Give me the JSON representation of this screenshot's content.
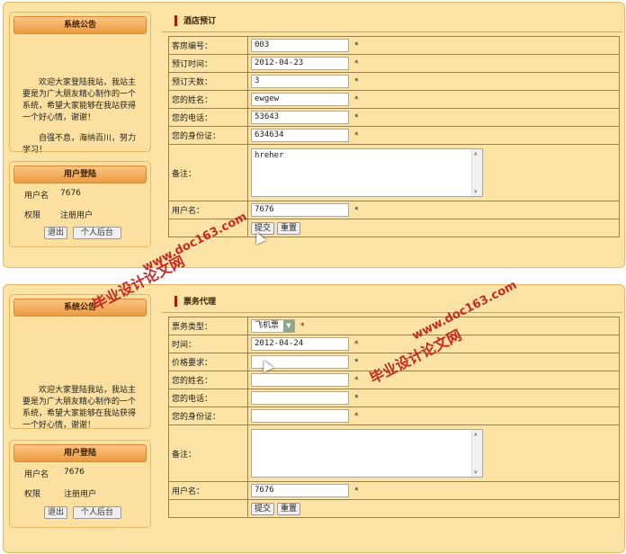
{
  "screens": [
    {
      "notice_title": "系统公告",
      "notice_paragraphs": [
        "欢迎大家登陆我站，我站主要是为广大朋友精心制作的一个系统，希望大家能够在我站获得一个好心情，谢谢！",
        "自强不息，海纳百川，努力学习！"
      ],
      "login_title": "用户登陆",
      "login_rows": [
        {
          "label": "用户名",
          "value": "7676"
        },
        {
          "label": "权限",
          "value": "注册用户"
        }
      ],
      "logout_label": "退出",
      "backend_label": "个人后台",
      "form_title": "酒店预订",
      "fields": [
        {
          "label": "客房编号：",
          "value": "003"
        },
        {
          "label": "预订时间：",
          "value": "2012-04-23"
        },
        {
          "label": "预订天数：",
          "value": "3"
        },
        {
          "label": "您的姓名：",
          "value": "ewgew"
        },
        {
          "label": "您的电话：",
          "value": "53643"
        },
        {
          "label": "您的身份证：",
          "value": "634634"
        }
      ],
      "remark_label": "备注：",
      "remark_value": "hreher",
      "user_label": "用户名：",
      "user_value": "7676",
      "required_mark": "*",
      "submit_label": "提交",
      "reset_label": "重置"
    },
    {
      "notice_title": "系统公告",
      "notice_paragraphs": [
        "欢迎大家登陆我站，我站主要是为广大朋友精心制作的一个系统，希望大家能够在我站获得一个好心情，谢谢！"
      ],
      "login_title": "用户登陆",
      "login_rows": [
        {
          "label": "用户名",
          "value": "7676"
        },
        {
          "label": "权限",
          "value": "注册用户"
        }
      ],
      "logout_label": "退出",
      "backend_label": "个人后台",
      "form_title": "票务代理",
      "type_label": "票务类型：",
      "type_value": "飞机票",
      "fields": [
        {
          "label": "时间：",
          "value": "2012-04-24"
        },
        {
          "label": "价格要求：",
          "value": ""
        },
        {
          "label": "您的姓名：",
          "value": ""
        },
        {
          "label": "您的电话：",
          "value": ""
        },
        {
          "label": "您的身份证：",
          "value": ""
        }
      ],
      "remark_label": "备注：",
      "remark_value": "",
      "user_label": "用户名：",
      "user_value": "7676",
      "required_mark": "*",
      "submit_label": "提交",
      "reset_label": "重置"
    }
  ],
  "watermark_cn": "毕业设计论文网",
  "watermark_url": "www.doc163.com"
}
